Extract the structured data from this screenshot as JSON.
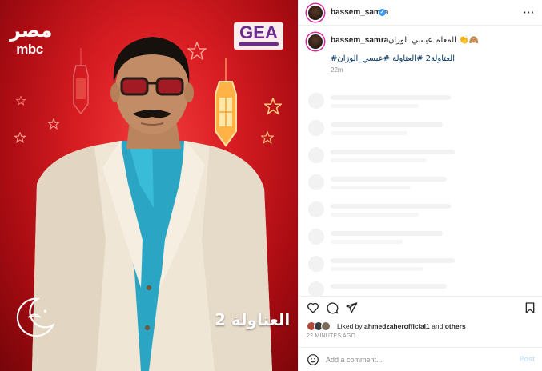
{
  "poster": {
    "channel_logo_arabic": "مصر",
    "channel_logo_latin": "mbc",
    "sponsor_logo": "GEA",
    "show_title": "العتاولة 2",
    "ramadan_mark_icon": "crescent-moon-icon"
  },
  "post": {
    "header": {
      "username": "bassem_samra",
      "verified_icon": "verified-badge-icon",
      "more_icon": "more-options-icon"
    },
    "caption": {
      "username": "bassem_samra",
      "text": "المعلم عيسي الوزان 👏🙈",
      "hashtags": "#العتاولة2 #العتاولة #عيسي_الوزان",
      "time_short": "22m"
    },
    "actions": {
      "like_icon": "heart-icon",
      "comment_icon": "comment-icon",
      "share_icon": "share-icon",
      "save_icon": "bookmark-icon"
    },
    "likes": {
      "prefix": "Liked by",
      "user": "ahmedzaherofficial1",
      "and": "and",
      "others": "others"
    },
    "time_long": "22 MINUTES AGO",
    "comment": {
      "placeholder": "Add a comment...",
      "post_label": "Post",
      "emoji_icon": "emoji-icon"
    }
  },
  "colors": {
    "accent_blue": "#3897f0",
    "link_blue": "#00376b",
    "poster_red": "#d81d22",
    "muted_text": "#8e8e8e"
  }
}
